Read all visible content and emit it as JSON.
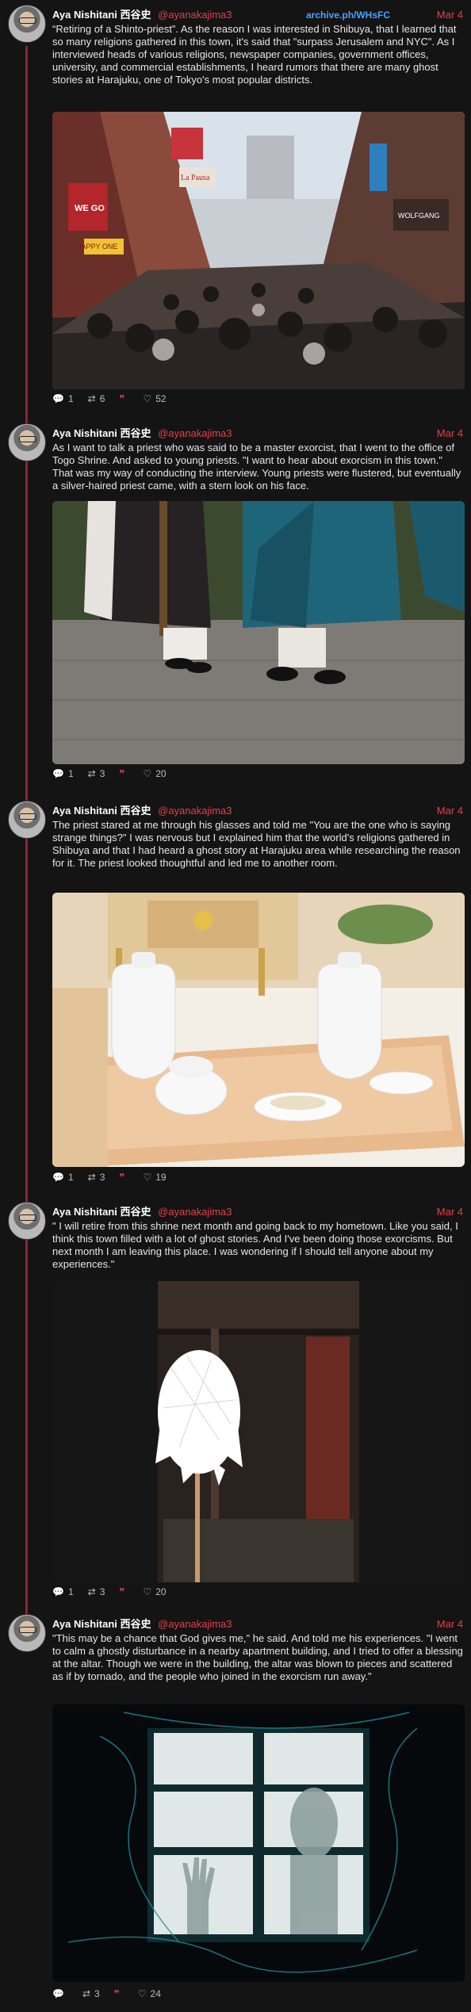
{
  "colors": {
    "accent": "#e2404a",
    "link": "#4aa3ff",
    "thread_line": "#8c2630",
    "background": "#141414"
  },
  "author": {
    "name": "Aya Nishitani 西谷史",
    "handle": "@ayanakajima3"
  },
  "icons": {
    "reply": "reply-icon",
    "retweet": "retweet-icon",
    "quote": "quote-icon",
    "like": "heart-icon"
  },
  "tweets": [
    {
      "date": "Mar 4",
      "archive_link": "archive.ph/WHsFC",
      "text": "“Retiring of a Shinto-priest”. As the reason I was interested in Shibuya, that I learned that so many religions gathered in this town, it's said that \"surpass Jerusalem and NYC\". As I interviewed heads of various religions, newspaper companies, government offices, university, and commercial establishments, I heard rumors that there are many ghost stories at Harajuku, one of Tokyo's most popular districts.",
      "media_signs": {
        "s1": "WE GO",
        "s2": "HAPPY ONE",
        "s3": "La Pausa",
        "s4": "WOLFGANG"
      },
      "replies": "1",
      "retweets": "6",
      "likes": "52"
    },
    {
      "date": "Mar 4",
      "text": "As I want to talk a priest who was said to be a master exorcist, that I went to the office of Togo Shrine. And asked to young priests. \"I want to hear about exorcism in this town.\" That was my way of conducting the interview. Young priests were flustered, but eventually a silver-haired priest came, with a stern look on his face.",
      "replies": "1",
      "retweets": "3",
      "likes": "20"
    },
    {
      "date": "Mar 4",
      "text": "The priest stared at me through his glasses and told me \"You are the one who is saying strange things?\" I was nervous but I explained him that the world's religions gathered in Shibuya and that I had heard a ghost story at Harajuku area while researching the reason for it. The priest looked thoughtful and led me to another room.",
      "replies": "1",
      "retweets": "3",
      "likes": "19"
    },
    {
      "date": "Mar 4",
      "text": "\" I will retire from this shrine next month and going back to my hometown. Like you said, I think this town filled with a lot of ghost stories. And I've been doing those exorcisms. But next month I am leaving this place. I was wondering if I should tell anyone about my experiences.\"",
      "replies": "1",
      "retweets": "3",
      "likes": "20"
    },
    {
      "date": "Mar 4",
      "text": "\"This may be a chance that God gives me,\" he said. And told me his experiences. \"I went to calm a ghostly disturbance in a nearby apartment building, and I tried to offer a blessing at the altar. Though we were in the building, the altar was blown to pieces and scattered as if by tornado, and the people who joined in the exorcism run away.\"",
      "replies": "",
      "retweets": "3",
      "likes": "24"
    }
  ]
}
